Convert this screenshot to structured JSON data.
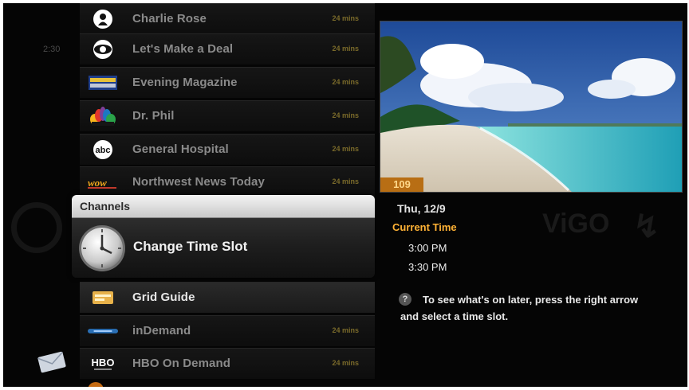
{
  "left_column": {
    "time": "2:30"
  },
  "programs_top": [
    {
      "title": "Charlie Rose",
      "duration": "24 mins",
      "logo": "pbs-logo"
    },
    {
      "title": "Let's Make a Deal",
      "duration": "24 mins",
      "logo": "cbs-eye-logo"
    },
    {
      "title": "Evening Magazine",
      "duration": "24 mins",
      "logo": "king5-logo"
    },
    {
      "title": "Dr. Phil",
      "duration": "24 mins",
      "logo": "nbc-peacock-logo"
    },
    {
      "title": "General Hospital",
      "duration": "24 mins",
      "logo": "abc-logo"
    },
    {
      "title": "Northwest News Today",
      "duration": "24 mins",
      "logo": "kwow-logo"
    }
  ],
  "channels_panel": {
    "header": "Channels",
    "selected_item": "Change Time Slot",
    "selected_icon": "clock-icon"
  },
  "programs_bottom": [
    {
      "title": "Grid Guide",
      "duration": "",
      "logo": "grid-guide-icon"
    },
    {
      "title": "inDemand",
      "duration": "24 mins",
      "logo": "indemand-logo"
    },
    {
      "title": "HBO On Demand",
      "duration": "24 mins",
      "logo": "hbo-logo"
    }
  ],
  "preview": {
    "channel_number": "109"
  },
  "info": {
    "date": "Thu, 12/9",
    "current_time_label": "Current Time",
    "time_slots": [
      "3:00 PM",
      "3:30 PM"
    ],
    "help_text": "To see what's on later, press the right arrow and select a time slot."
  },
  "colors": {
    "accent": "#ffb235",
    "channel_badge": "#b86e14"
  }
}
